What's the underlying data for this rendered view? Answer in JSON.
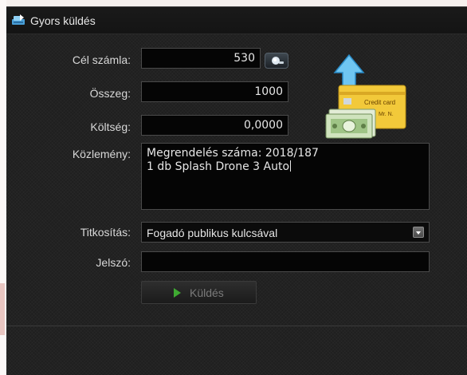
{
  "window": {
    "title": "Gyors küldés",
    "title_icon": "transfer-icon"
  },
  "form": {
    "target_account": {
      "label": "Cél számla:",
      "value": "530"
    },
    "amount": {
      "label": "Összeg:",
      "value": "1000"
    },
    "fee": {
      "label": "Költség:",
      "value": "0,0000"
    },
    "memo": {
      "label": "Közlemény:",
      "value": "Megrendelés száma: 2018/187\n1 db Splash Drone 3 Auto"
    },
    "encryption": {
      "label": "Titkosítás:",
      "value": "Fogadó publikus kulcsával"
    },
    "password": {
      "label": "Jelszó:",
      "value": ""
    },
    "send_button": {
      "label": "Küldés"
    }
  },
  "illustration": {
    "icon": "payment-card-cash-icon",
    "card_text": "Credit card",
    "card_name": "Mr. N."
  },
  "colors": {
    "window_bg": "#1f1f1f",
    "field_bg": "#050505",
    "accent_blue": "#3aa0e0",
    "send_green": "#3faa32"
  }
}
